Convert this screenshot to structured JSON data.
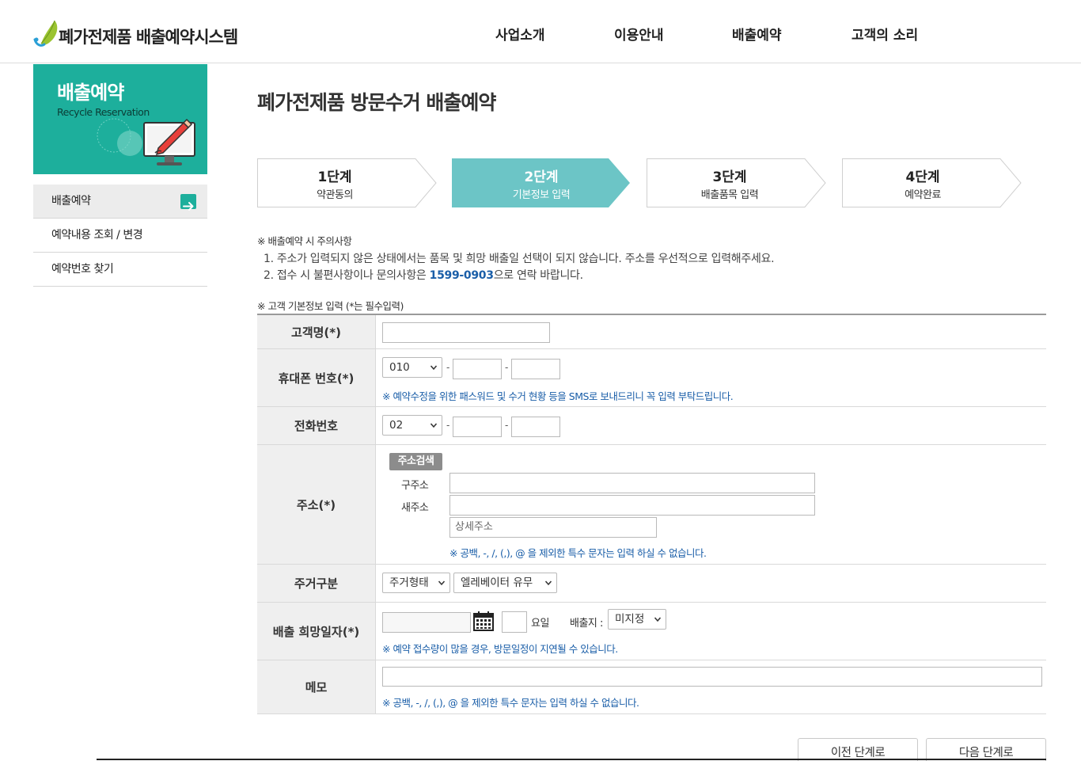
{
  "site": {
    "logo_text": "폐가전제품 배출예약시스템"
  },
  "gnb": [
    {
      "label": "사업소개"
    },
    {
      "label": "이용안내"
    },
    {
      "label": "배출예약"
    },
    {
      "label": "고객의 소리"
    }
  ],
  "sidebar": {
    "title": "배출예약",
    "subtitle": "Recycle Reservation",
    "items": [
      {
        "label": "배출예약",
        "active": true
      },
      {
        "label": "예약내용 조회 / 변경",
        "active": false
      },
      {
        "label": "예약번호 찾기",
        "active": false
      }
    ],
    "accent_color": "#1daf9c"
  },
  "page": {
    "title": "폐가전제품 방문수거 배출예약"
  },
  "steps": [
    {
      "num": "1단계",
      "label": "약관동의",
      "active": false
    },
    {
      "num": "2단계",
      "label": "기본정보 입력",
      "active": true
    },
    {
      "num": "3단계",
      "label": "배출품목 입력",
      "active": false
    },
    {
      "num": "4단계",
      "label": "예약완료",
      "active": false
    }
  ],
  "step_active_color": "#6cc5c6",
  "notice": {
    "heading": "※ 배출예약 시 주의사항",
    "line1": "1. 주소가 입력되지 않은 상태에서는 품목 및 희망 배출일 선택이 되지 않습니다. 주소를 우선적으로 입력해주세요.",
    "line2_before": "2. 접수 시 불편사항이나 문의사항은 ",
    "line2_phone": "1599-0903",
    "line2_after": "으로 연락 바랍니다."
  },
  "form": {
    "heading": "※ 고객 기본정보 입력 (*는 필수입력)",
    "name_label": "고객명(*)",
    "mobile_label": "휴대폰 번호(*)",
    "mobile_prefix": "010",
    "mobile_help": "※ 예약수정을 위한 패스워드 및 수거 현황 등을 SMS로 보내드리니 꼭 입력 부탁드립니다.",
    "phone_label": "전화번호",
    "phone_prefix": "02",
    "address_label": "주소(*)",
    "address_search_button": "주소검색",
    "old_address_label": "구주소",
    "new_address_label": "새주소",
    "detail_address_placeholder": "상세주소",
    "address_help": "※ 공백, -, /, (,), @ 을 제외한 특수 문자는 입력 하실 수 없습니다.",
    "housing_label": "주거구분",
    "housing_type_select": "주거형태",
    "elevator_select": "엘레베이터 유무",
    "date_label": "배출 희망일자(*)",
    "weekday_label": "요일",
    "location_label": "배출지 :",
    "location_select": "미지정",
    "date_help": "※ 예약 접수량이 많을 경우, 방문일정이 지연될 수 있습니다.",
    "memo_label": "메모",
    "memo_help": "※ 공백, -, /, (,), @ 을 제외한 특수 문자는 입력 하실 수 없습니다."
  },
  "buttons": {
    "prev": "이전 단계로",
    "next": "다음 단계로"
  },
  "help_color": "#1a5ea8"
}
